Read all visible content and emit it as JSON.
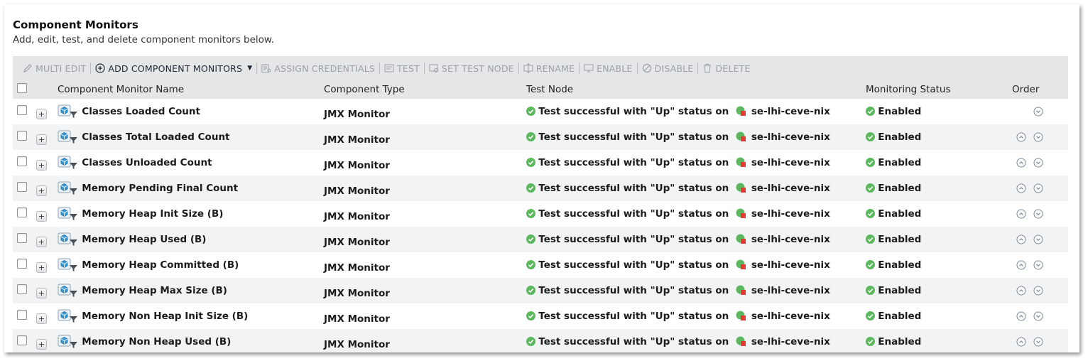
{
  "header": {
    "title": "Component Monitors",
    "subtitle": "Add, edit, test, and delete component monitors below."
  },
  "toolbar": {
    "items": [
      {
        "label": "MULTI EDIT",
        "icon": "pencil-icon",
        "enabled": false
      },
      {
        "label": "ADD COMPONENT MONITORS",
        "icon": "plus-circle-icon",
        "enabled": true,
        "dropdown": true
      },
      {
        "label": "ASSIGN CREDENTIALS",
        "icon": "credentials-icon",
        "enabled": false
      },
      {
        "label": "TEST",
        "icon": "test-icon",
        "enabled": false
      },
      {
        "label": "SET TEST NODE",
        "icon": "test-node-icon",
        "enabled": false
      },
      {
        "label": "RENAME",
        "icon": "rename-icon",
        "enabled": false
      },
      {
        "label": "ENABLE",
        "icon": "enable-icon",
        "enabled": false
      },
      {
        "label": "DISABLE",
        "icon": "disable-icon",
        "enabled": false
      },
      {
        "label": "DELETE",
        "icon": "trash-icon",
        "enabled": false
      }
    ]
  },
  "columns": {
    "name": "Component Monitor Name",
    "type": "Component Type",
    "test_node": "Test Node",
    "status": "Monitoring Status",
    "order": "Order"
  },
  "test_text": "Test successful with \"Up\" status on",
  "rows": [
    {
      "name": "Classes Loaded Count",
      "type": "JMX Monitor",
      "node": "se-lhi-ceve-nix",
      "status": "Enabled",
      "up": false,
      "down": true
    },
    {
      "name": "Classes Total Loaded Count",
      "type": "JMX Monitor",
      "node": "se-lhi-ceve-nix",
      "status": "Enabled",
      "up": true,
      "down": true
    },
    {
      "name": "Classes Unloaded Count",
      "type": "JMX Monitor",
      "node": "se-lhi-ceve-nix",
      "status": "Enabled",
      "up": true,
      "down": true
    },
    {
      "name": "Memory Pending Final Count",
      "type": "JMX Monitor",
      "node": "se-lhi-ceve-nix",
      "status": "Enabled",
      "up": true,
      "down": true
    },
    {
      "name": "Memory Heap Init Size (B)",
      "type": "JMX Monitor",
      "node": "se-lhi-ceve-nix",
      "status": "Enabled",
      "up": true,
      "down": true
    },
    {
      "name": "Memory Heap Used (B)",
      "type": "JMX Monitor",
      "node": "se-lhi-ceve-nix",
      "status": "Enabled",
      "up": true,
      "down": true
    },
    {
      "name": "Memory Heap Committed (B)",
      "type": "JMX Monitor",
      "node": "se-lhi-ceve-nix",
      "status": "Enabled",
      "up": true,
      "down": true
    },
    {
      "name": "Memory Heap Max Size (B)",
      "type": "JMX Monitor",
      "node": "se-lhi-ceve-nix",
      "status": "Enabled",
      "up": true,
      "down": true
    },
    {
      "name": "Memory Non Heap Init Size (B)",
      "type": "JMX Monitor",
      "node": "se-lhi-ceve-nix",
      "status": "Enabled",
      "up": true,
      "down": true
    },
    {
      "name": "Memory Non Heap Used (B)",
      "type": "JMX Monitor",
      "node": "se-lhi-ceve-nix",
      "status": "Enabled",
      "up": true,
      "down": true
    }
  ],
  "colors": {
    "ok_green": "#5cb85c",
    "node_red": "#e53935",
    "toolbar_bg": "#e4e6e8",
    "disabled_text": "#9aa1a6"
  }
}
